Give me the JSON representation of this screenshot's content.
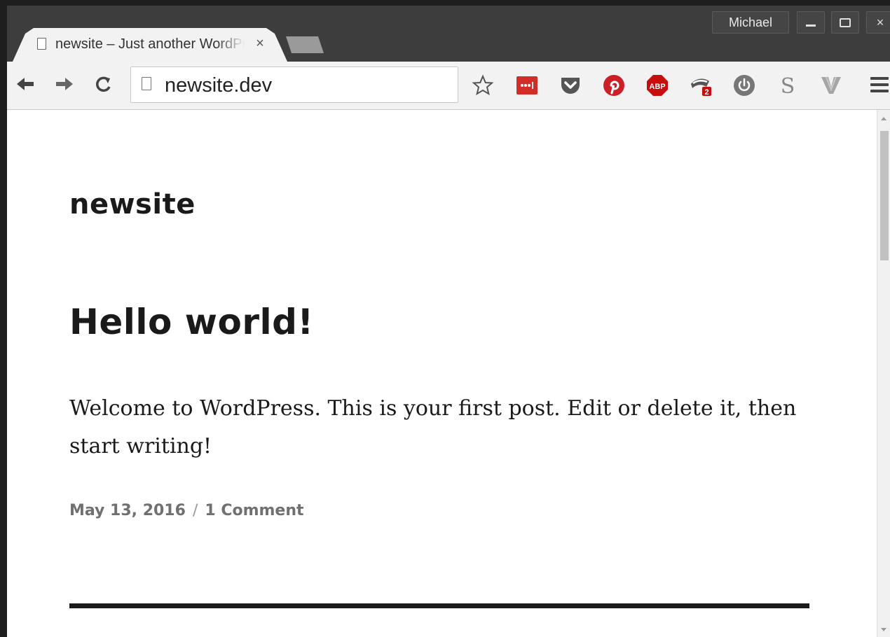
{
  "browser": {
    "tab_title": "newsite – Just another WordPress site",
    "close_glyph": "×",
    "profile_name": "Michael",
    "url": "newsite.dev",
    "extensions": [
      {
        "name": "bookmark-star-icon"
      },
      {
        "name": "lastpass-icon",
        "color": "#d32d27"
      },
      {
        "name": "pocket-icon",
        "color": "#555555"
      },
      {
        "name": "pinterest-icon",
        "color": "#cb2027"
      },
      {
        "name": "adblock-plus-icon",
        "color": "#c70d0d",
        "label": "ABP"
      },
      {
        "name": "privacy-badger-icon",
        "badge": "2"
      },
      {
        "name": "power-icon",
        "color": "#777777"
      },
      {
        "name": "s-icon",
        "label": "S"
      },
      {
        "name": "v-icon",
        "color": "#9a9a9a"
      }
    ]
  },
  "page": {
    "site_title": "newsite",
    "post_title": "Hello world!",
    "post_body": "Welcome to WordPress. This is your first post. Edit or delete it, then start writing!",
    "post_date": "May 13, 2016",
    "meta_separator": "/",
    "comments_link": "1 Comment"
  }
}
